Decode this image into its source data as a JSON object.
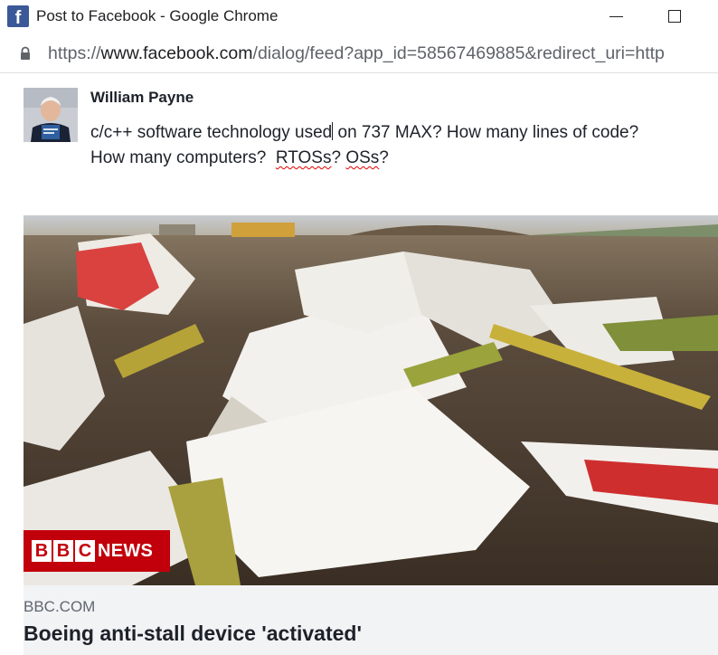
{
  "window": {
    "title": "Post to Facebook - Google Chrome",
    "favicon_letter": "f"
  },
  "address_bar": {
    "scheme": "https://",
    "host": "www.facebook.com",
    "path": "/dialog/feed?app_id=58567469885&redirect_uri=http"
  },
  "post": {
    "author": "William Payne",
    "text_line1_before_cursor": "c/c++ software technology used",
    "text_line1_after_cursor": " on 737 MAX? How many lines of code?",
    "text_line2_a": "How many computers?  ",
    "text_line2_misspelled_1": "RTOSs",
    "text_line2_mid": "? ",
    "text_line2_misspelled_2": "OSs",
    "text_line2_end": "?"
  },
  "link_preview": {
    "badge_letters": [
      "B",
      "B",
      "C"
    ],
    "badge_word": "NEWS",
    "domain": "BBC.COM",
    "headline": "Boeing anti-stall device 'activated'"
  },
  "colors": {
    "facebook_blue": "#3b5998",
    "bbc_red": "#c2000b",
    "spellcheck_red": "#e00000",
    "preview_footer_bg": "#f2f3f5"
  },
  "icons": [
    "facebook-favicon",
    "minimize-icon",
    "maximize-icon",
    "lock-icon"
  ]
}
